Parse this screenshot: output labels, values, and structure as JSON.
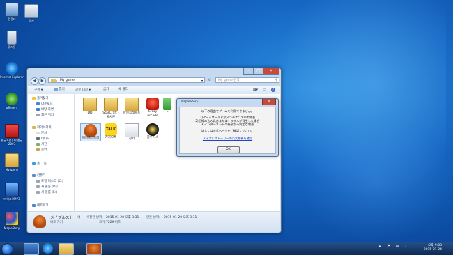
{
  "desktop": {
    "icons": [
      {
        "label": "컴퓨터",
        "icon": "computer-icon"
      },
      {
        "label": "정키",
        "icon": "folder-icon"
      },
      {
        "label": "휴지통",
        "icon": "recycle-bin-icon"
      },
      {
        "label": "Internet Explorer",
        "icon": "internet-explorer-icon"
      },
      {
        "label": "uTorrent",
        "icon": "utorrent-icon"
      },
      {
        "label": "한글과컴퓨터 한글 2007",
        "icon": "hangul-icon"
      },
      {
        "label": "My game",
        "icon": "folder-icon"
      },
      {
        "label": "마이크로MP3",
        "icon": "mp3-icon"
      },
      {
        "label": "MapleStory",
        "icon": "game-icon"
      }
    ]
  },
  "explorer": {
    "address": "My game",
    "search_placeholder": "My game 검색",
    "toolbar": {
      "organize": "구성",
      "open": "열기",
      "include_library": "공유 대상",
      "share": "굽기",
      "new_folder": "새 폴더"
    },
    "nav": {
      "favorites": "즐겨찾기",
      "favorites_items": [
        "다운로드",
        "바탕 화면",
        "최근 위치"
      ],
      "libraries": "라이브러리",
      "libraries_items": [
        "문서",
        "비디오",
        "사진",
        "음악"
      ],
      "homegroup": "홈 그룹",
      "computer": "컴퓨터",
      "computer_items": [
        "로컬 디스크 (C:)",
        "새 볼륨 (D:)",
        "새 볼륨 (E:)"
      ],
      "network": "네트워크"
    },
    "files": [
      {
        "label": "DD",
        "icon": "folder-icon"
      },
      {
        "label": "StarCraft - 복사본",
        "icon": "folder-icon"
      },
      {
        "label": "마인크래프트",
        "icon": "folder-icon"
      },
      {
        "label": "Crazy Arcade",
        "icon": "crazy-arcade-icon"
      },
      {
        "label": "L",
        "icon": "app-icon"
      },
      {
        "label": "메이플스토리",
        "icon": "maplestory-icon"
      },
      {
        "label": "카카오톡",
        "icon": "kakaotalk-icon"
      },
      {
        "label": "정키",
        "icon": "document-icon"
      },
      {
        "label": "블루치스",
        "icon": "game-icon"
      }
    ],
    "details": {
      "name": "メイプルストーリー",
      "type": "바로 가기",
      "modified_label": "수정한 날짜:",
      "modified": "2015-01-20 오후 3:31",
      "created_label": "만든 날짜:",
      "created": "2015-01-20 오후 3:31",
      "size_label": "크기:",
      "size": "722바이트"
    }
  },
  "dialog": {
    "title": "MapleStory",
    "line1": "以下の理由でゲームを利用できません。",
    "line2": "1)ゲームワールドがメンテナンス中の場合",
    "line3": "2)回線の込み具合またはトラブルが発生した場合",
    "line4": "3)インターネットの接続が不安定な場合",
    "line5": "詳しくは公式ページをご確認ください。",
    "link": "メイプルストーリーの公式最新を確認",
    "ok": "OK"
  },
  "taskbar": {
    "clock_time": "오후 9:03",
    "clock_date": "2015-01-24"
  },
  "colors": {
    "desktop": "#1668c4",
    "window_frame": "#c6d9ee",
    "close_red": "#c74b3a",
    "link": "#2244cc"
  }
}
